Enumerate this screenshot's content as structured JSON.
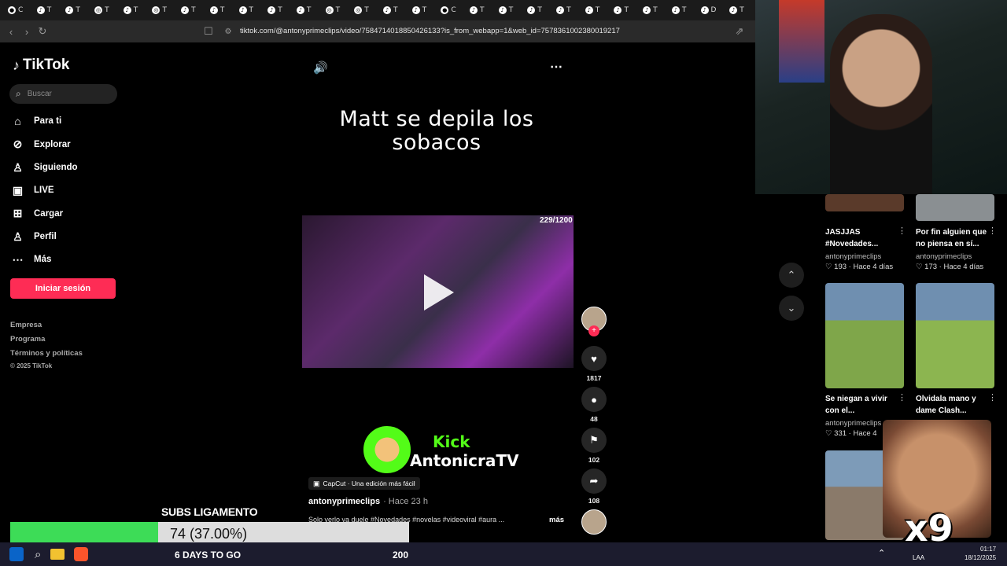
{
  "browser": {
    "tabs": [
      {
        "icon": "chrome-icon",
        "letter": "C"
      },
      {
        "icon": "tiktok-icon",
        "letter": "T"
      },
      {
        "icon": "tiktok-icon",
        "letter": "T"
      },
      {
        "icon": "globe-icon",
        "letter": "T"
      },
      {
        "icon": "tiktok-icon",
        "letter": "T"
      },
      {
        "icon": "globe-icon",
        "letter": "T"
      },
      {
        "icon": "tiktok-icon",
        "letter": "T"
      },
      {
        "icon": "tiktok-icon",
        "letter": "T"
      },
      {
        "icon": "tiktok-icon",
        "letter": "T"
      },
      {
        "icon": "tiktok-icon",
        "letter": "T"
      },
      {
        "icon": "tiktok-icon",
        "letter": "T"
      },
      {
        "icon": "globe-icon",
        "letter": "T"
      },
      {
        "icon": "globe-icon",
        "letter": "T"
      },
      {
        "icon": "tiktok-icon",
        "letter": "T"
      },
      {
        "icon": "tiktok-icon",
        "letter": "T"
      },
      {
        "icon": "chrome-icon",
        "letter": "C"
      },
      {
        "icon": "tiktok-icon",
        "letter": "T"
      },
      {
        "icon": "tiktok-icon",
        "letter": "T"
      },
      {
        "icon": "tiktok-icon",
        "letter": "T"
      },
      {
        "icon": "tiktok-icon",
        "letter": "T"
      },
      {
        "icon": "tiktok-icon",
        "letter": "T"
      },
      {
        "icon": "tiktok-icon",
        "letter": "T"
      },
      {
        "icon": "tiktok-icon",
        "letter": "T"
      },
      {
        "icon": "tiktok-icon",
        "letter": "T"
      },
      {
        "icon": "tiktok-icon",
        "letter": "D"
      },
      {
        "icon": "tiktok-icon",
        "letter": "T"
      }
    ],
    "url": "tiktok.com/@antonyprimeclips/video/7584714018850426133?is_from_webapp=1&web_id=7578361002380019217"
  },
  "sidebar": {
    "logo": "TikTok",
    "search_placeholder": "Buscar",
    "items": [
      {
        "label": "Para ti",
        "icon": "home-icon"
      },
      {
        "label": "Explorar",
        "icon": "compass-icon"
      },
      {
        "label": "Siguiendo",
        "icon": "following-icon"
      },
      {
        "label": "LIVE",
        "icon": "live-icon"
      },
      {
        "label": "Cargar",
        "icon": "upload-icon"
      },
      {
        "label": "Perfil",
        "icon": "profile-icon"
      },
      {
        "label": "Más",
        "icon": "more-icon"
      }
    ],
    "login_label": "Iniciar sesión",
    "footer": [
      "Empresa",
      "Programa",
      "Términos y políticas",
      "© 2025 TikTok"
    ]
  },
  "video": {
    "title": "Matt se depila los sobacos",
    "counter": "229/1200",
    "likes": "1817",
    "comments": "48",
    "saves": "102",
    "shares": "108",
    "kick_label": "Kick",
    "kick_name": "AntonicraTV",
    "capcut": "CapCut · Una edición más fácil",
    "author": "antonyprimeclips",
    "time": "· Hace 23 h",
    "description": "Solo verlo ya duele #Novedades #novelas #videoviral #aura ...",
    "more": "más"
  },
  "related": [
    {
      "title": "JASJJAS #Novedades...",
      "user": "antonyprimeclips",
      "likes": "193",
      "ago": "Hace 4 días"
    },
    {
      "title": "Por fin alguien que no piensa en sí...",
      "user": "antonyprimeclips",
      "likes": "173",
      "ago": "Hace 4 días"
    },
    {
      "title": "Se niegan a vivir con el...",
      "user": "antonyprimeclips",
      "likes": "331",
      "ago": "Hace 4"
    },
    {
      "title": "Olvidala mano y dame Clash...",
      "user": "",
      "likes": "",
      "ago": ""
    }
  ],
  "overlay": {
    "subs_title": "SUBS LIGAMENTO",
    "subs_value": "74 (37.00%)",
    "subs_fraction": 0.37,
    "days_to_go": "6 DAYS TO GO",
    "goal": "200",
    "x9": "x9",
    "time": "01:17",
    "date": "18/12/2025",
    "lang": "LAA"
  }
}
